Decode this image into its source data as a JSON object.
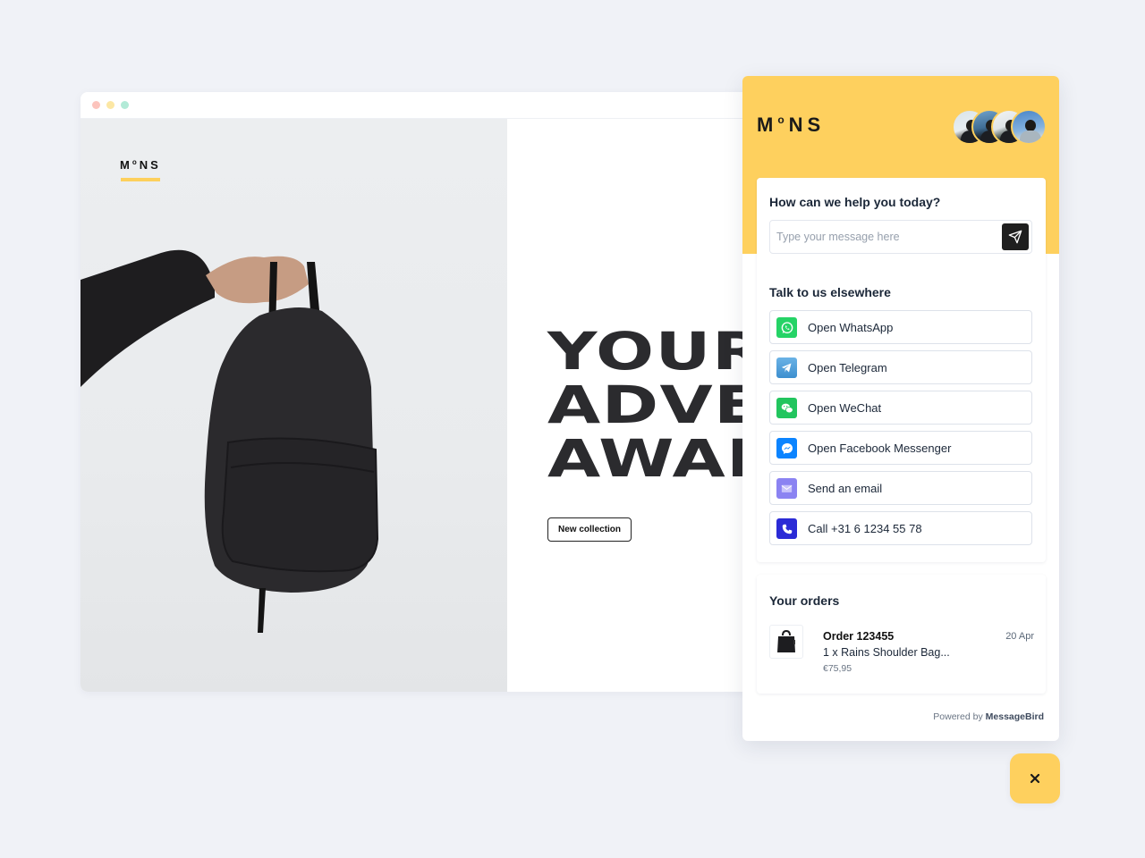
{
  "browser": {
    "window_controls": [
      "close",
      "minimize",
      "maximize"
    ]
  },
  "site": {
    "logo": {
      "main_left": "M",
      "superscript": "o",
      "main_right": "NS"
    },
    "hero_image": "person-holding-black-backpack",
    "headline_lines": [
      "YOUR",
      "ADVE",
      "AWAI"
    ],
    "headline": "YOUR\nADVE\nAWAI",
    "cta_label": "New collection",
    "accent_color": "#fdd05c"
  },
  "widget": {
    "logo": {
      "main_left": "M",
      "superscript": "o",
      "main_right": "NS"
    },
    "header_color": "#fed05e",
    "agent_avatars": [
      "agent-1",
      "agent-2",
      "agent-3",
      "agent-4"
    ],
    "help": {
      "title": "How can we help you today?",
      "input_value": "",
      "input_placeholder": "Type your message here",
      "send_icon": "paper-plane-icon"
    },
    "elsewhere": {
      "title": "Talk to us elsewhere",
      "channels": [
        {
          "label": "Open WhatsApp",
          "icon": "whatsapp-icon",
          "color": "#25d366"
        },
        {
          "label": "Open Telegram",
          "icon": "telegram-icon",
          "color": "#4fa3dc"
        },
        {
          "label": "Open WeChat",
          "icon": "wechat-icon",
          "color": "#22c55e"
        },
        {
          "label": "Open Facebook Messenger",
          "icon": "messenger-icon",
          "color": "#0b84ff"
        },
        {
          "label": "Send an email",
          "icon": "email-icon",
          "color": "#8b83f2"
        },
        {
          "label": "Call +31 6 1234 55 78",
          "icon": "phone-icon",
          "color": "#2b2bd6"
        }
      ]
    },
    "orders": {
      "title": "Your orders",
      "items": [
        {
          "id": "Order 123455",
          "date": "20 Apr",
          "description": "1 x Rains Shoulder Bag...",
          "price": "€75,95",
          "thumbnail": "black-bag"
        }
      ]
    },
    "powered_by": {
      "prefix": "Powered by ",
      "brand": "MessageBird"
    }
  },
  "close_button": {
    "icon": "close-icon",
    "label": "×"
  }
}
